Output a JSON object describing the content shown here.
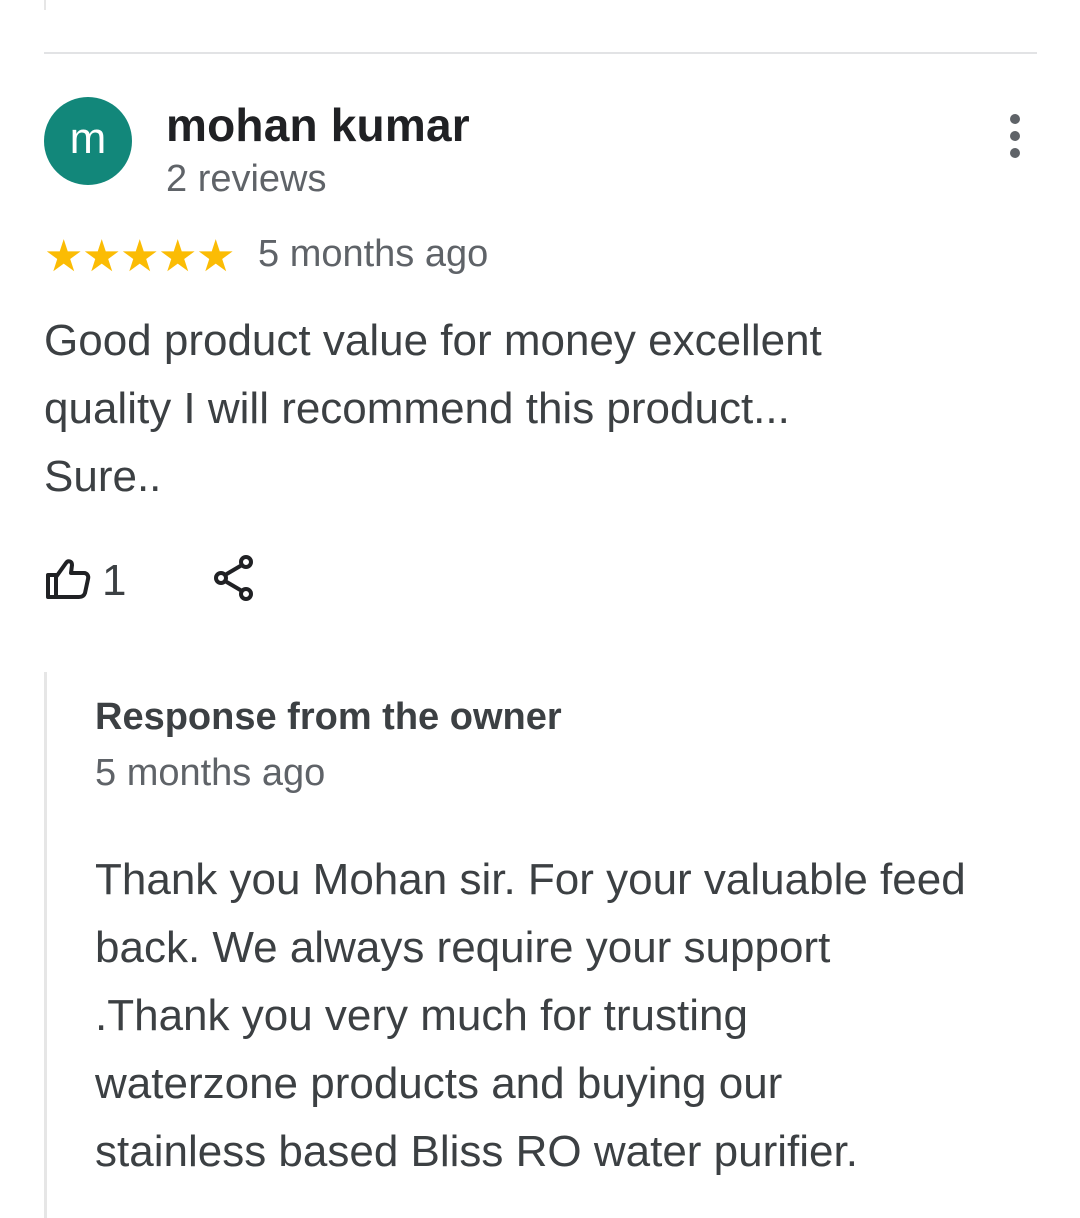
{
  "review": {
    "avatar_letter": "m",
    "reviewer_name": "mohan kumar",
    "reviewer_reviews": "2 reviews",
    "rating": 5,
    "rating_max": 5,
    "star_glyph": "★",
    "time": "5 months ago",
    "text_lines": [
      "Good product value for money excellent",
      "quality I will recommend this product...",
      "Sure.."
    ],
    "like_count": "1",
    "icons": {
      "more": "more-vert-icon",
      "like": "thumb-up-icon",
      "share": "share-icon"
    }
  },
  "owner_response": {
    "label": "Response from the owner",
    "time": "5 months ago",
    "text_lines": [
      "Thank you Mohan sir. For your valuable feed",
      "back. We always require your support",
      ".Thank you very much for trusting",
      "waterzone products and buying our",
      "stainless based Bliss RO water purifier."
    ]
  },
  "colors": {
    "avatar_bg": "#12877a",
    "star": "#fbbc04",
    "primary_text": "#202124",
    "body_text": "#3c4043",
    "secondary_text": "#5f6368"
  }
}
